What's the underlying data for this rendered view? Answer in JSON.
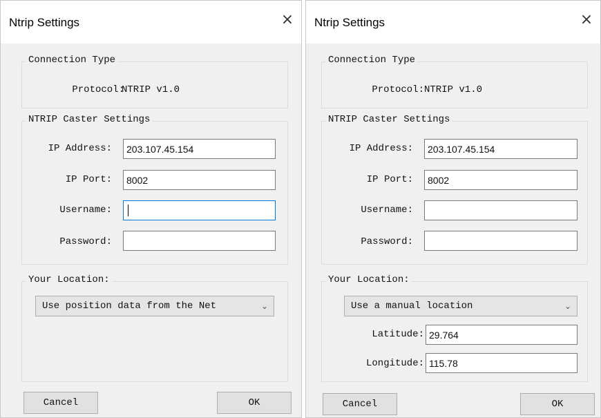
{
  "left_dialog": {
    "title": "Ntrip Settings",
    "close_glyph": "×",
    "connection_type": {
      "legend": "Connection Type",
      "protocol_label": "Protocol:",
      "protocol_value": "NTRIP v1.0"
    },
    "caster_settings": {
      "legend": "NTRIP Caster Settings",
      "ip_address_label": "IP Address:",
      "ip_address_value": "203.107.45.154",
      "ip_port_label": "IP Port:",
      "ip_port_value": "8002",
      "username_label": "Username:",
      "username_value": "",
      "password_label": "Password:",
      "password_value": ""
    },
    "location": {
      "legend": "Your Location:",
      "selected": "Use position data from the Net"
    },
    "buttons": {
      "cancel": "Cancel",
      "ok": "OK"
    }
  },
  "right_dialog": {
    "title": "Ntrip Settings",
    "close_glyph": "×",
    "connection_type": {
      "legend": "Connection Type",
      "protocol_label": "Protocol:",
      "protocol_value": "NTRIP v1.0"
    },
    "caster_settings": {
      "legend": "NTRIP Caster Settings",
      "ip_address_label": "IP Address:",
      "ip_address_value": "203.107.45.154",
      "ip_port_label": "IP Port:",
      "ip_port_value": "8002",
      "username_label": "Username:",
      "username_value": "",
      "password_label": "Password:",
      "password_value": ""
    },
    "location": {
      "legend": "Your Location:",
      "selected": "Use a manual location",
      "latitude_label": "Latitude:",
      "latitude_value": "29.764",
      "longitude_label": "Longitude:",
      "longitude_value": "115.78"
    },
    "buttons": {
      "cancel": "Cancel",
      "ok": "OK"
    }
  },
  "icons": {
    "close": "close-icon",
    "dropdown": "chevron-down-icon"
  },
  "colors": {
    "dialog_bg": "#f0f0f0",
    "titlebar_bg": "#ffffff",
    "focus_border": "#0078d7",
    "button_bg": "#e1e1e1"
  }
}
